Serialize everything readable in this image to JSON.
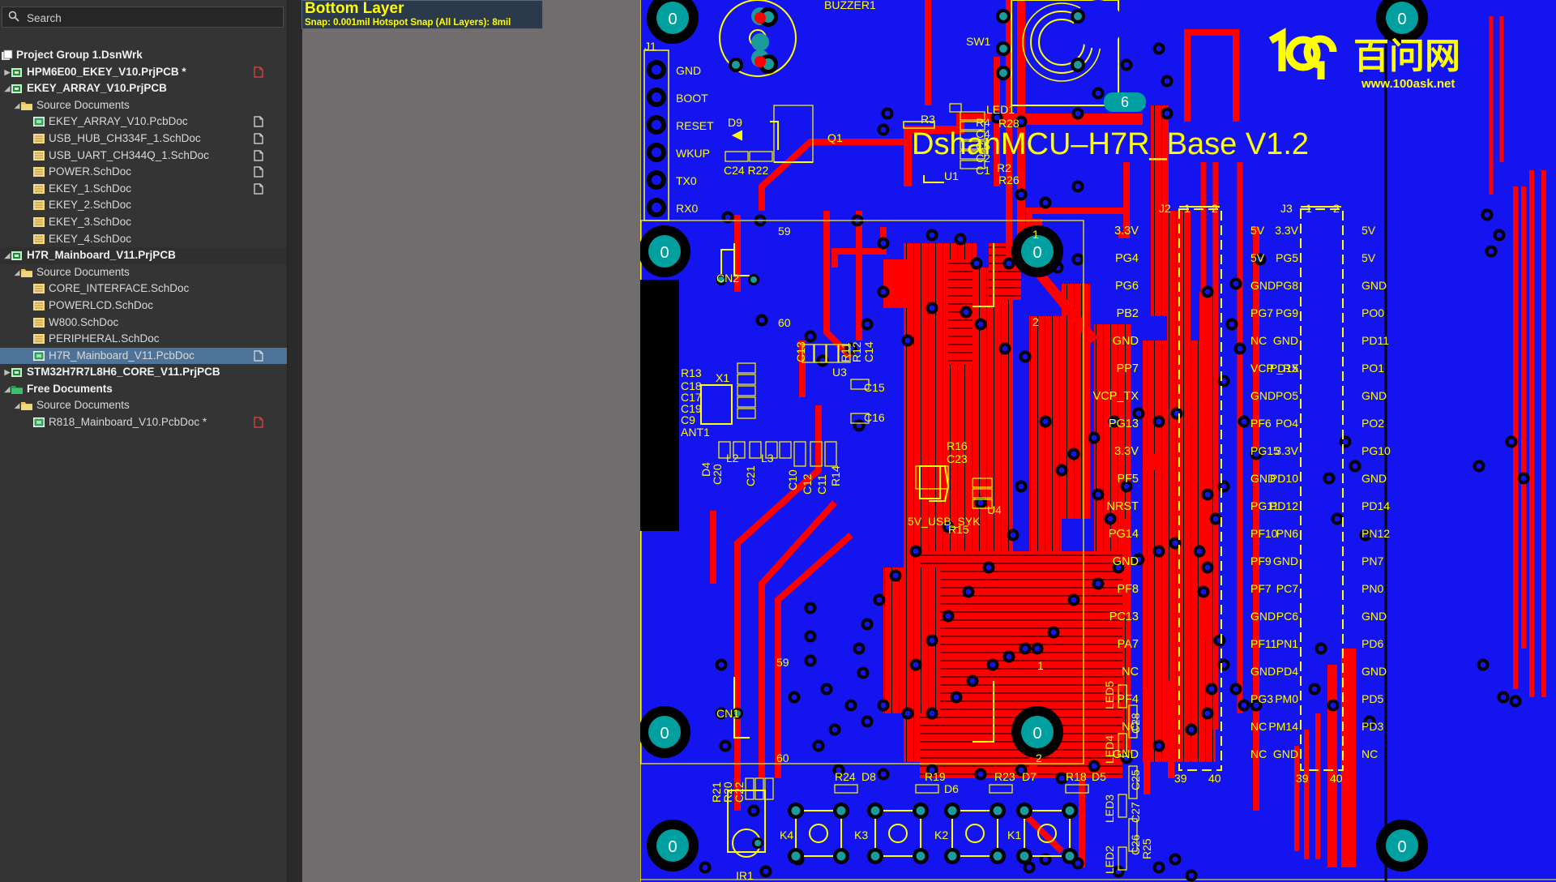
{
  "search": {
    "placeholder": "Search"
  },
  "tree": [
    {
      "label": "Project Group 1.DsnWrk",
      "level": 0,
      "icon": "project-group-icon",
      "bold": true
    },
    {
      "label": "HPM6E00_EKEY_V10.PrjPCB *",
      "level": 1,
      "icon": "pcb-project-icon",
      "bold": true,
      "arrow": "right",
      "status": "modified"
    },
    {
      "label": "EKEY_ARRAY_V10.PrjPCB",
      "level": 1,
      "icon": "pcb-project-icon",
      "bold": true,
      "arrow": "down"
    },
    {
      "label": "Source Documents",
      "level": 2,
      "icon": "folder-icon",
      "arrow": "down"
    },
    {
      "label": "EKEY_ARRAY_V10.PcbDoc",
      "level": 3,
      "icon": "pcbdoc-icon",
      "status": "saved"
    },
    {
      "label": "USB_HUB_CH334F_1.SchDoc",
      "level": 3,
      "icon": "schdoc-icon",
      "status": "saved"
    },
    {
      "label": "USB_UART_CH344Q_1.SchDoc",
      "level": 3,
      "icon": "schdoc-icon",
      "status": "saved"
    },
    {
      "label": "POWER.SchDoc",
      "level": 3,
      "icon": "schdoc-icon",
      "status": "saved"
    },
    {
      "label": "EKEY_1.SchDoc",
      "level": 3,
      "icon": "schdoc-icon",
      "status": "saved"
    },
    {
      "label": "EKEY_2.SchDoc",
      "level": 3,
      "icon": "schdoc-icon"
    },
    {
      "label": "EKEY_3.SchDoc",
      "level": 3,
      "icon": "schdoc-icon"
    },
    {
      "label": "EKEY_4.SchDoc",
      "level": 3,
      "icon": "schdoc-icon"
    },
    {
      "label": "H7R_Mainboard_V11.PrjPCB",
      "level": 1,
      "icon": "pcb-project-icon",
      "bold": true,
      "arrow": "down",
      "highlight": true
    },
    {
      "label": "Source Documents",
      "level": 2,
      "icon": "folder-icon",
      "arrow": "down"
    },
    {
      "label": "CORE_INTERFACE.SchDoc",
      "level": 3,
      "icon": "schdoc-icon"
    },
    {
      "label": "POWERLCD.SchDoc",
      "level": 3,
      "icon": "schdoc-icon"
    },
    {
      "label": "W800.SchDoc",
      "level": 3,
      "icon": "schdoc-icon"
    },
    {
      "label": "PERIPHERAL.SchDoc",
      "level": 3,
      "icon": "schdoc-icon"
    },
    {
      "label": "H7R_Mainboard_V11.PcbDoc",
      "level": 3,
      "icon": "pcbdoc-icon",
      "status": "saved",
      "selected": true
    },
    {
      "label": "STM32H7R7L8H6_CORE_V11.PrjPCB",
      "level": 1,
      "icon": "pcb-project-icon",
      "bold": true,
      "arrow": "right"
    },
    {
      "label": "Free Documents",
      "level": 1,
      "icon": "free-docs-icon",
      "bold": true,
      "arrow": "down"
    },
    {
      "label": "Source Documents",
      "level": 2,
      "icon": "folder-icon",
      "arrow": "down"
    },
    {
      "label": "R818_Mainboard_V10.PcbDoc *",
      "level": 3,
      "icon": "pcbdoc-icon",
      "status": "modified"
    }
  ],
  "layer_tip": {
    "title": "Bottom Layer",
    "snap": "Snap: 0.001mil Hotspot Snap (All Layers): 8mil"
  },
  "colors": {
    "board": "#1414f0",
    "copper": "#ff0000",
    "silkscreen": "#ffff00",
    "pad": "#d9d9d9",
    "mounting_hole": "#00a0a0",
    "panel": "#343434",
    "selection": "#4e7398",
    "workspace": "#716d6e"
  },
  "pcb": {
    "board_title": "DshanMCU–H7R_Base  V1.2",
    "logo_text": "百问网",
    "logo_url": "www.100ask.net",
    "hole_label": "0",
    "knob_label": "6",
    "j1": {
      "ref": "J1",
      "pins": [
        "GND",
        "BOOT",
        "RESET",
        "WKUP",
        "TX0",
        "RX0"
      ]
    },
    "j2": {
      "ref": "J2",
      "left": [
        "3.3V",
        "PG4",
        "PG6",
        "PB2",
        "GND",
        "PP7",
        "VCP_TX",
        "PG13",
        "3.3V",
        "PF5",
        "NRST",
        "PG14",
        "GND",
        "PF8",
        "PC13",
        "PA7",
        "NC",
        "PF4",
        "NC",
        "GND"
      ],
      "pin_top_left": "1",
      "pin_top_right": "2",
      "pin_bottom_left": "39",
      "pin_bottom_right": "40"
    },
    "j3": {
      "ref": "J3",
      "left_a": [
        "5V",
        "5V",
        "GND",
        "PG7",
        "NC",
        "VCP _RX",
        "GND",
        "PF6",
        "PG15",
        "GND",
        "PG11",
        "PF10",
        "PF9",
        "PF7",
        "GND",
        "PF11",
        "GND",
        "PG3",
        "NC",
        "NC"
      ],
      "left_b": [
        "3.3V",
        "PG5",
        "PG8",
        "PG9",
        "GND",
        "PD15",
        "PO5",
        "PO4",
        "3.3V",
        "PD10",
        "PD12",
        "PN6",
        "GND",
        "PC7",
        "PC6",
        "PN1",
        "PD4",
        "PM0",
        "PM14",
        "GND"
      ],
      "right": [
        "5V",
        "5V",
        "GND",
        "PO0",
        "PD11",
        "PO1",
        "GND",
        "PO2",
        "PG10",
        "GND",
        "PD14",
        "PN12",
        "PN7",
        "PN0",
        "GND",
        "PD6",
        "GND",
        "PD5",
        "PD3",
        "NC"
      ],
      "pin_top_left": "1",
      "pin_top_right": "2",
      "pin_bottom_left": "39",
      "pin_bottom_right": "40"
    },
    "designators": [
      {
        "t": "BUZZER1",
        "id": "buzzer1"
      },
      {
        "t": "SW1",
        "id": "sw1"
      },
      {
        "t": "D9",
        "id": "d9"
      },
      {
        "t": "Q1",
        "id": "q1"
      },
      {
        "t": "C24 R22",
        "id": "c24-r22"
      },
      {
        "t": "R3",
        "id": "r3"
      },
      {
        "t": "LED1",
        "id": "led1"
      },
      {
        "t": "R4",
        "id": "r4"
      },
      {
        "t": "R28",
        "id": "r28"
      },
      {
        "t": "C4",
        "id": "c4"
      },
      {
        "t": "C5",
        "id": "c5"
      },
      {
        "t": "C2",
        "id": "c2"
      },
      {
        "t": "C1",
        "id": "c1"
      },
      {
        "t": "R2",
        "id": "r2"
      },
      {
        "t": "R26",
        "id": "r26"
      },
      {
        "t": "U1",
        "id": "u1"
      },
      {
        "t": "CN2",
        "id": "cn2"
      },
      {
        "t": "CN1",
        "id": "cn1"
      },
      {
        "t": "59",
        "id": "cn2-59"
      },
      {
        "t": "60",
        "id": "cn2-60"
      },
      {
        "t": "1",
        "id": "cn2-1"
      },
      {
        "t": "2",
        "id": "cn2-2"
      },
      {
        "t": "59",
        "id": "cn1-59"
      },
      {
        "t": "60",
        "id": "cn1-60"
      },
      {
        "t": "1",
        "id": "cn1-1"
      },
      {
        "t": "2",
        "id": "cn1-2"
      },
      {
        "t": "R13",
        "id": "r13"
      },
      {
        "t": "C18",
        "id": "c18"
      },
      {
        "t": "C17",
        "id": "c17"
      },
      {
        "t": "C19",
        "id": "c19"
      },
      {
        "t": "C9",
        "id": "c9"
      },
      {
        "t": "ANT1",
        "id": "ant1"
      },
      {
        "t": "X1",
        "id": "x1"
      },
      {
        "t": "U3",
        "id": "u3"
      },
      {
        "t": "C13",
        "id": "c13"
      },
      {
        "t": "R11",
        "id": "r11"
      },
      {
        "t": "R12",
        "id": "r12"
      },
      {
        "t": "C14",
        "id": "c14"
      },
      {
        "t": "C15",
        "id": "c15"
      },
      {
        "t": "C16",
        "id": "c16"
      },
      {
        "t": "L2",
        "id": "l2"
      },
      {
        "t": "L3",
        "id": "l3"
      },
      {
        "t": "D4",
        "id": "d4"
      },
      {
        "t": "C20",
        "id": "c20"
      },
      {
        "t": "C21",
        "id": "c21"
      },
      {
        "t": "C10",
        "id": "c10"
      },
      {
        "t": "C12",
        "id": "c12"
      },
      {
        "t": "C11",
        "id": "c11"
      },
      {
        "t": "R14",
        "id": "r14"
      },
      {
        "t": "R16",
        "id": "r16"
      },
      {
        "t": "C23",
        "id": "c23"
      },
      {
        "t": "5V_USB_SYK",
        "id": "5v-usb-syk"
      },
      {
        "t": "R15",
        "id": "r15"
      },
      {
        "t": "U4",
        "id": "u4"
      },
      {
        "t": "R21",
        "id": "r21"
      },
      {
        "t": "R20",
        "id": "r20"
      },
      {
        "t": "C22",
        "id": "c22"
      },
      {
        "t": "IR1",
        "id": "ir1"
      },
      {
        "t": "R24",
        "id": "r24"
      },
      {
        "t": "D8",
        "id": "d8"
      },
      {
        "t": "K4",
        "id": "k4"
      },
      {
        "t": "R19",
        "id": "r19"
      },
      {
        "t": "D6",
        "id": "d6"
      },
      {
        "t": "K3",
        "id": "k3"
      },
      {
        "t": "R23",
        "id": "r23"
      },
      {
        "t": "D7",
        "id": "d7"
      },
      {
        "t": "K2",
        "id": "k2"
      },
      {
        "t": "R18",
        "id": "r18"
      },
      {
        "t": "D5",
        "id": "d5"
      },
      {
        "t": "K1",
        "id": "k1"
      },
      {
        "t": "LED5",
        "id": "led5"
      },
      {
        "t": "LED4",
        "id": "led4"
      },
      {
        "t": "LED3",
        "id": "led3"
      },
      {
        "t": "LED2",
        "id": "led2"
      },
      {
        "t": "C28",
        "id": "c28"
      },
      {
        "t": "C25",
        "id": "c25"
      },
      {
        "t": "C27",
        "id": "c27"
      },
      {
        "t": "C26",
        "id": "c26"
      },
      {
        "t": "R25",
        "id": "r25"
      }
    ]
  }
}
